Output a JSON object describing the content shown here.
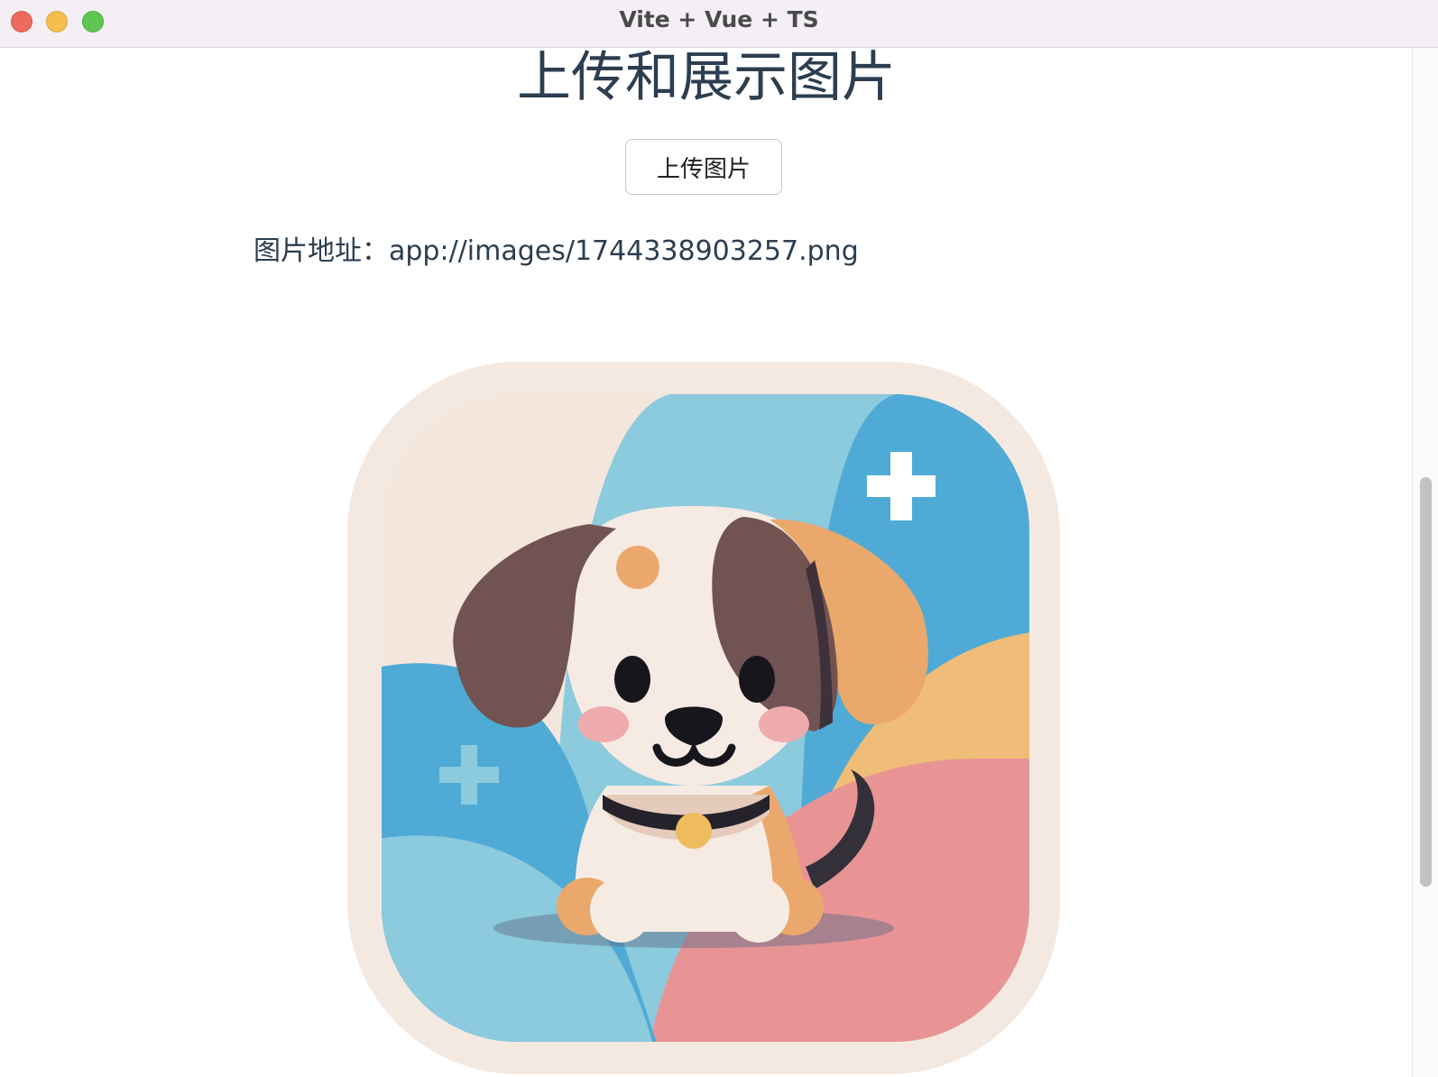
{
  "window": {
    "title": "Vite + Vue + TS"
  },
  "page": {
    "heading": "上传和展示图片",
    "upload_label": "上传图片",
    "address_label": "图片地址：",
    "address_value": "app://images/1744338903257.png"
  },
  "image": {
    "icon_name": "puppy-app-icon"
  },
  "colors": {
    "heading": "#2c3e50",
    "close": "#ec6a5e",
    "minimize": "#f4bf4f",
    "maximize": "#61c554"
  }
}
